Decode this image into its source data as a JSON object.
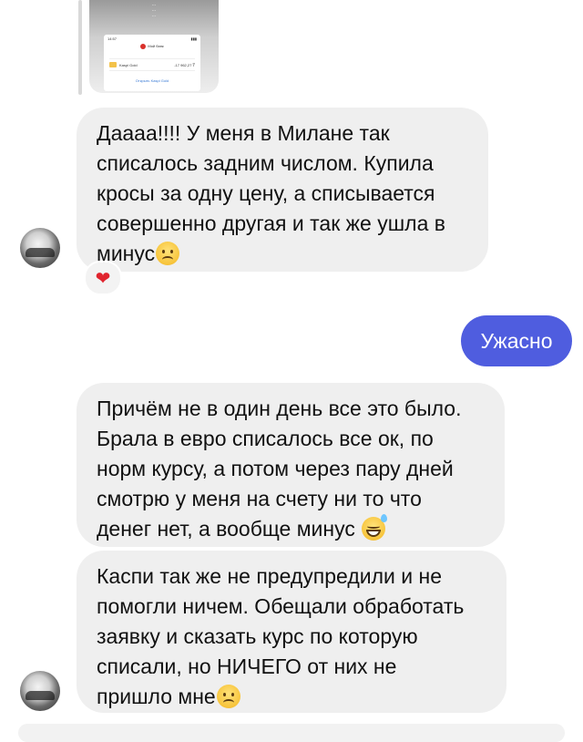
{
  "story_preview": {
    "caption_lines": [
      "...",
      "...",
      "..."
    ],
    "phone": {
      "time": "14:57",
      "bank_name": "Мой банк",
      "card_label": "Kaspi Gold",
      "card_amount": "-17 962,27 ₸",
      "link": "Открыть Kaspi Gold"
    }
  },
  "messages": [
    {
      "lines": [
        "Даааа!!!! У меня в Милане так",
        "списалось задним числом. Купила",
        "кросы за одну цену, а списывается",
        "совершенно другая и так же ушла в",
        "минус"
      ],
      "emoji": "sad-face"
    },
    {
      "reaction": "❤"
    },
    {
      "text": "Ужасно"
    },
    {
      "lines": [
        "Причём не в один день все это было.",
        "Брала в евро списалось все ок, по",
        "норм курсу, а потом через пару дней",
        "смотрю у меня на счету ни то что",
        "денег нет, а вообще минус"
      ],
      "emoji": "grin-sweat"
    },
    {
      "lines": [
        "Каспи так же не предупредили и не",
        "помогли ничем. Обещали обработать",
        "заявку и сказать курс по которую",
        "списали, но НИЧЕГО от них не",
        "пришло мне"
      ],
      "emoji": "sad-face"
    }
  ],
  "colors": {
    "incoming_bubble": "#efefef",
    "outgoing_bubble": "#4f5ddf",
    "reaction_heart": "#e0242e"
  }
}
